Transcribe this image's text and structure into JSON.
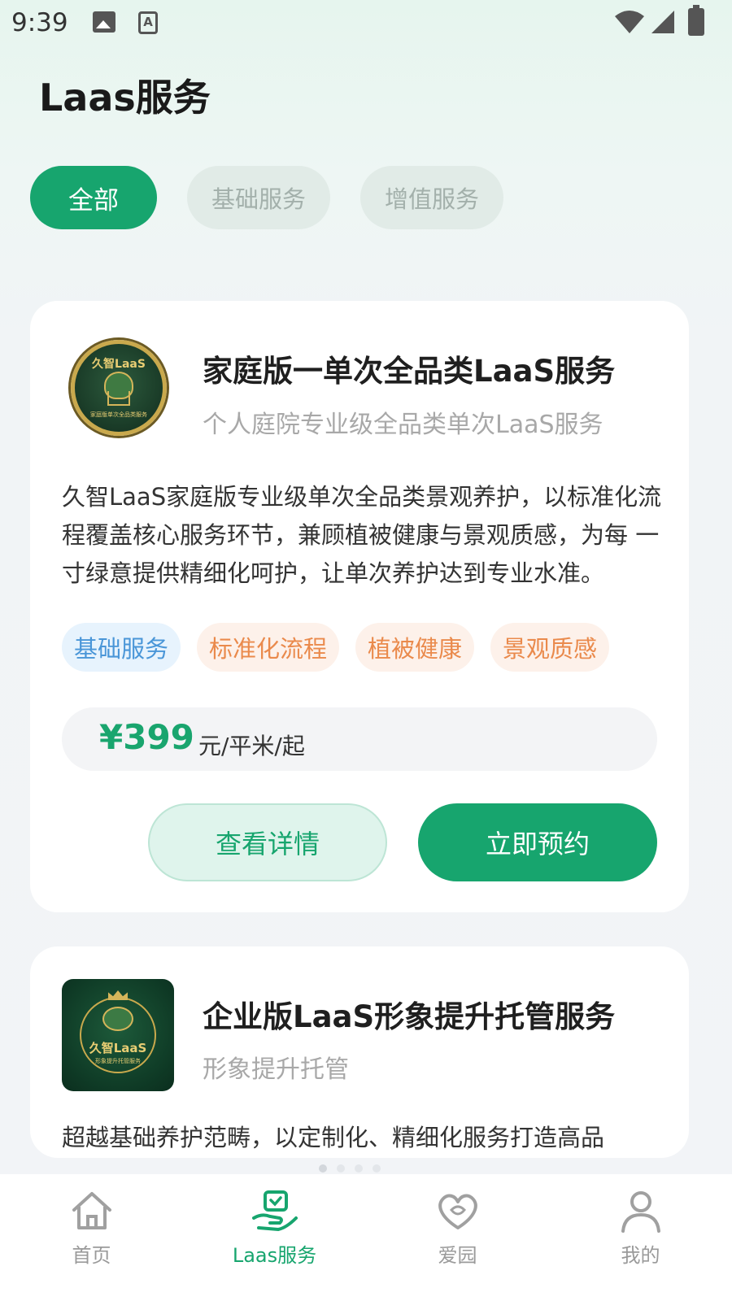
{
  "status_bar": {
    "time": "9:39",
    "a_glyph": "A"
  },
  "header": {
    "title": "Laas服务"
  },
  "tabs": [
    {
      "label": "全部",
      "active": true
    },
    {
      "label": "基础服务",
      "active": false
    },
    {
      "label": "增值服务",
      "active": false
    }
  ],
  "services": [
    {
      "logo": {
        "title": "久智LaaS",
        "sub": "家庭版单次全品类服务"
      },
      "title": "家庭版一单次全品类LaaS服务",
      "subtitle": "个人庭院专业级全品类单次LaaS服务",
      "description": "久智LaaS家庭版专业级单次全品类景观养护，以标准化流程覆盖核心服务环节，兼顾植被健康与景观质感，为每 一寸绿意提供精细化呵护，让单次养护达到专业水准。",
      "tags": [
        "基础服务",
        "标准化流程",
        "植被健康",
        "景观质感"
      ],
      "price": "¥399",
      "price_unit": "元/平米/起",
      "detail_button": "查看详情",
      "book_button": "立即预约"
    },
    {
      "logo": {
        "title": "久智LaaS",
        "sub": "形象提升托管服务"
      },
      "title": "企业版LaaS形象提升托管服务",
      "subtitle": "形象提升托管",
      "description": "超越基础养护范畴，以定制化、精细化服务打造高品"
    }
  ],
  "nav": [
    {
      "label": "首页",
      "icon": "home-icon",
      "active": false
    },
    {
      "label": "Laas服务",
      "icon": "service-hand-icon",
      "active": true
    },
    {
      "label": "爱园",
      "icon": "heart-leaf-icon",
      "active": false
    },
    {
      "label": "我的",
      "icon": "person-icon",
      "active": false
    }
  ],
  "colors": {
    "primary": "#17a56e",
    "tag_blue": "#4a96d8",
    "tag_orange": "#ea8a4c"
  }
}
